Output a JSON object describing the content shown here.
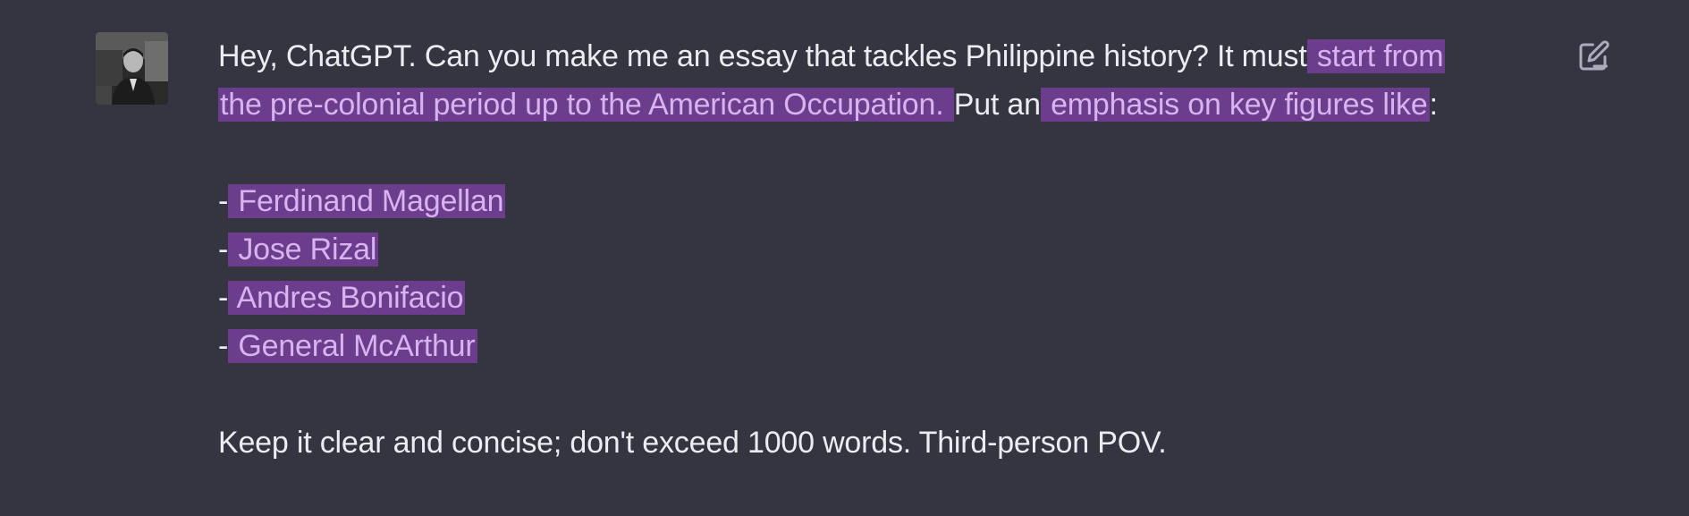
{
  "message": {
    "line1_plain": "Hey, ChatGPT. Can you make me an essay that tackles Philippine history? It must",
    "line1_hl": " start from ",
    "line2_hl": " the pre-colonial period up to the American Occupation. ",
    "line2_plain": "Put an",
    "line2_hl2": " emphasis on key figures like",
    "line2_end": ":",
    "bullets": [
      {
        "dash": "-",
        "text": " Ferdinand Magellan "
      },
      {
        "dash": "-",
        "text": " Jose Rizal "
      },
      {
        "dash": "-",
        "text": " Andres Bonifacio "
      },
      {
        "dash": "-",
        "text": " General McArthur"
      }
    ],
    "closing": "Keep it clear and concise; don't exceed 1000 words. Third-person POV."
  },
  "icons": {
    "avatar": "user-avatar",
    "edit": "edit-icon"
  },
  "colors": {
    "background": "#343541",
    "text": "#ececf1",
    "highlight_bg": "#6b3d8c",
    "highlight_text": "#d7b3f0",
    "icon": "#acacbe"
  }
}
